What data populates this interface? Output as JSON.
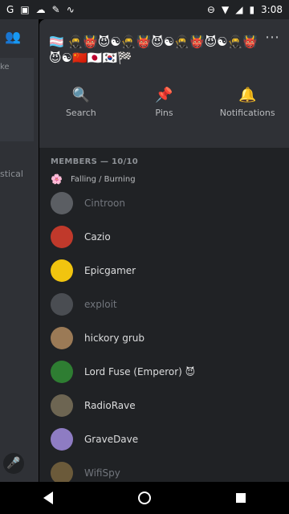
{
  "statusbar": {
    "time": "3:08",
    "left_icons": [
      "G",
      "▣",
      "☁",
      "✎",
      "∿"
    ],
    "right_icons": [
      "⊖",
      "▼",
      "◢",
      "▮"
    ]
  },
  "background": {
    "peek_text_1": "ke",
    "peek_text_2": "stical"
  },
  "drawer": {
    "title": "🏳️‍⚧️ 🥷👹😈☯🥷👹😈☯🥷👹😈☯🥷👹😈☯🇨🇳🇯🇵🇰🇷🏁",
    "actions": [
      {
        "icon": "search-icon",
        "label": "Search"
      },
      {
        "icon": "pin-icon",
        "label": "Pins"
      },
      {
        "icon": "bell-icon",
        "label": "Notifications"
      }
    ],
    "members_header": "MEMBERS — 10/10",
    "status_line": "Falling / Burning",
    "members": [
      {
        "name": "Cintroon",
        "offline": true,
        "color": "#5b5e63"
      },
      {
        "name": "Cazio",
        "offline": false,
        "color": "#c0392b"
      },
      {
        "name": "Epicgamer",
        "offline": false,
        "color": "#f1c40f"
      },
      {
        "name": "exploit",
        "offline": true,
        "color": "#4a4d52"
      },
      {
        "name": "hickory grub",
        "offline": false,
        "color": "#9b7a56"
      },
      {
        "name": "Lord Fuse (Emperor) 😈",
        "offline": false,
        "color": "#2e7d32"
      },
      {
        "name": "RadioRave",
        "offline": false,
        "color": "#6d6552"
      },
      {
        "name": "GraveDave",
        "offline": false,
        "color": "#8e7cc3"
      },
      {
        "name": "WifiSpy",
        "offline": true,
        "color": "#6b5a3a"
      }
    ]
  }
}
